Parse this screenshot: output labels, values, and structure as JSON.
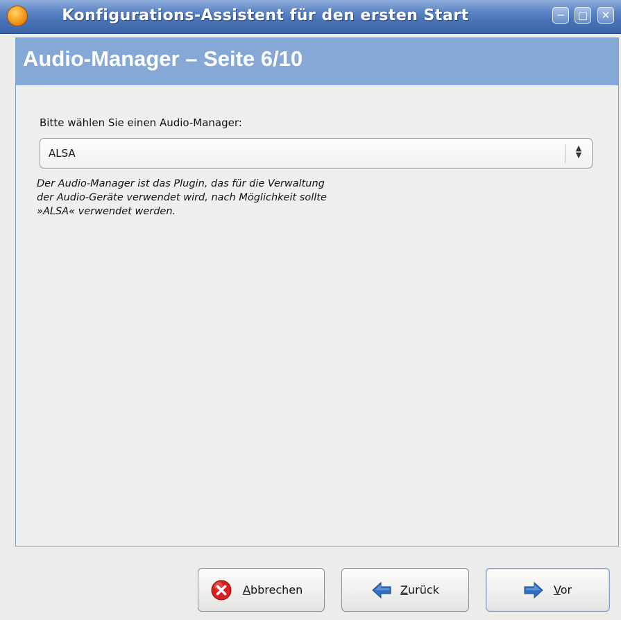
{
  "window": {
    "title": "Konfigurations-Assistent für den ersten Start",
    "controls": {
      "minimize": "minimize-icon",
      "maximize": "maximize-icon",
      "close": "close-icon"
    }
  },
  "page": {
    "title": "Audio-Manager – Seite 6/10",
    "prompt": "Bitte wählen Sie einen Audio-Manager:",
    "audio_manager": {
      "selected": "ALSA"
    },
    "description": "Der Audio-Manager ist das Plugin, das für die Verwaltung der Audio-Geräte verwendet wird, nach Möglichkeit sollte »ALSA« verwendet werden."
  },
  "buttons": {
    "cancel": {
      "mnemonic": "A",
      "rest": "bbrechen",
      "icon": "cancel-icon"
    },
    "back": {
      "mnemonic": "Z",
      "rest": "urück",
      "icon": "arrow-left-icon"
    },
    "next": {
      "mnemonic": "V",
      "rest": "or",
      "icon": "arrow-right-icon"
    }
  },
  "colors": {
    "titlebar": "#4a74b8",
    "header_band": "#86a8d6",
    "cancel_red": "#d92020",
    "arrow_blue": "#2f6fc4"
  }
}
